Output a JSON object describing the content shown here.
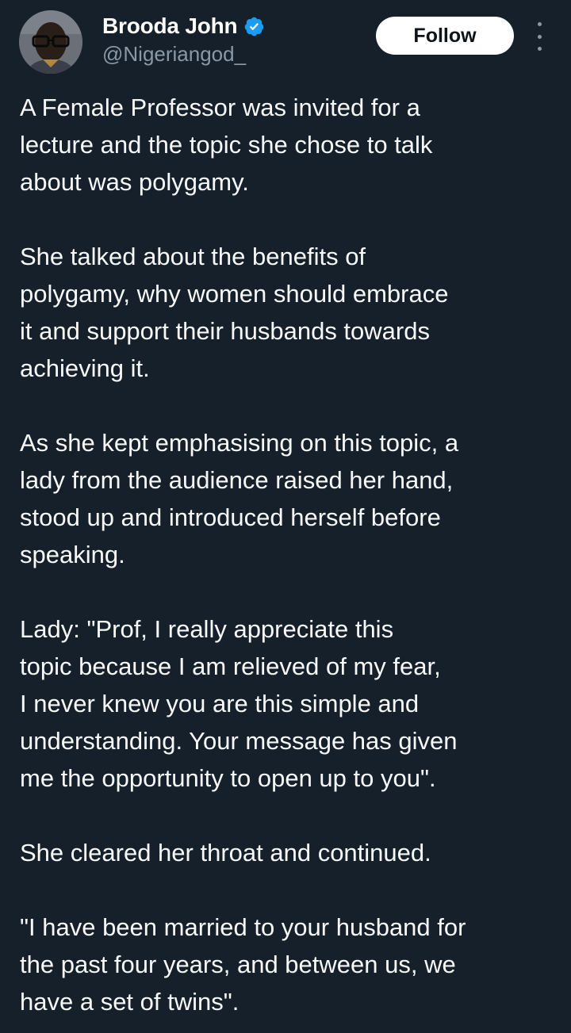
{
  "author": {
    "display_name": "Brooda John",
    "handle": "@Nigeriangod_",
    "verified": true,
    "verified_icon": "verified-badge-icon",
    "avatar": "profile-photo"
  },
  "actions": {
    "follow_label": "Follow",
    "more_icon": "more-options-icon"
  },
  "tweet": {
    "paragraphs": [
      "A Female Professor was invited for a\nlecture and the topic she chose to talk\nabout was polygamy.",
      "She talked about the benefits of\npolygamy, why women should embrace\nit and support their husbands towards\nachieving it.",
      "As she kept emphasising on this topic, a\nlady from the audience raised her hand,\nstood up and introduced herself before\nspeaking.",
      "Lady: \"Prof, I really appreciate this\ntopic because I am  relieved of my fear,\nI never knew you are this simple and\nunderstanding. Your message has given\nme the opportunity to open up to you\".",
      "She cleared her throat and continued.",
      "\"I have been married to your husband for\nthe past four years, and between us, we\nhave a set of twins\"."
    ]
  },
  "colors": {
    "background": "#15202b",
    "text_primary": "#f7f9f9",
    "text_secondary": "#8b98a5",
    "verified_blue": "#1d9bf0",
    "follow_bg": "#ffffff",
    "follow_text": "#0f1419"
  }
}
